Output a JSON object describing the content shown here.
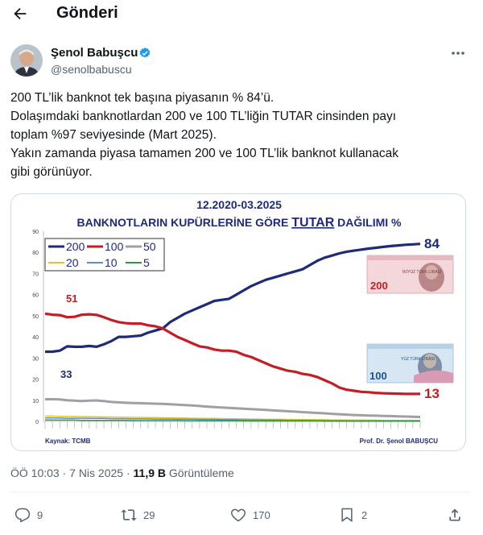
{
  "header": {
    "title": "Gönderi"
  },
  "author": {
    "name": "Şenol Babuşcu",
    "handle": "@senolbabuscu"
  },
  "tweet": {
    "lines": [
      "200 TL’lik banknot tek başına piyasanın % 84’ü.",
      "Dolaşımdaki banknotlardan 200 ve 100 TL’liğin TUTAR cinsinden payı",
      "toplam %97 seviyesinde (Mart 2025).",
      "Yakın zamanda piyasa tamamen 200 ve 100 TL’lik banknot kullanacak",
      "gibi görünüyor."
    ]
  },
  "chart_data": {
    "type": "line",
    "title": "12.2020-03.2025",
    "subtitle_pre": "BANKNOTLARIN KUPÜRLERİNE GÖRE ",
    "subtitle_em": "TUTAR",
    "subtitle_post": " DAĞILIMI %",
    "ylim": [
      0,
      90
    ],
    "yticks": [
      "0",
      "10",
      "20",
      "30",
      "40",
      "50",
      "60",
      "70",
      "80",
      "90"
    ],
    "x": [
      0,
      1,
      2,
      3,
      4,
      5,
      6,
      7,
      8,
      9,
      10,
      11,
      12,
      13,
      14,
      15,
      16,
      17,
      18,
      19,
      20,
      21,
      22,
      23,
      24,
      25,
      26,
      27,
      28,
      29,
      30,
      31,
      32,
      33,
      34,
      35,
      36,
      37,
      38,
      39,
      40,
      41,
      42,
      43,
      44,
      45,
      46,
      47,
      48,
      49,
      50,
      51
    ],
    "series": [
      {
        "name": "200",
        "color": "#1f2a7a",
        "width": 3.2,
        "values": [
          33,
          33,
          33.5,
          35.5,
          35.3,
          35.3,
          35.7,
          35.3,
          36.5,
          38,
          40,
          40,
          40.3,
          40.6,
          42,
          43,
          44,
          47,
          49,
          51,
          52.5,
          54,
          55.5,
          57,
          57.5,
          58,
          60,
          62,
          64,
          65.5,
          67,
          68,
          69,
          70,
          71,
          72,
          74,
          76,
          77.5,
          78.5,
          79.5,
          80.3,
          80.8,
          81.3,
          81.8,
          82.2,
          82.6,
          83,
          83.3,
          83.6,
          83.8,
          84
        ]
      },
      {
        "name": "100",
        "color": "#c41e24",
        "width": 3.2,
        "values": [
          51,
          50.5,
          50.3,
          49.3,
          49.5,
          50.5,
          50.7,
          50.4,
          49.3,
          48,
          47,
          46.5,
          46.3,
          46.3,
          45.5,
          45,
          44,
          42,
          40,
          38.5,
          37,
          35.5,
          35,
          34,
          33.5,
          33.5,
          33,
          31.5,
          30.5,
          29,
          27.5,
          26,
          25,
          24,
          23.5,
          22.5,
          22,
          21,
          19.5,
          18,
          16,
          15,
          14.5,
          14,
          13.8,
          13.5,
          13.3,
          13.2,
          13.1,
          13,
          13,
          13
        ]
      },
      {
        "name": "50",
        "color": "#9ea0a4",
        "width": 3,
        "values": [
          10.5,
          10.5,
          10.4,
          10,
          9.8,
          9.6,
          9.8,
          9.9,
          9.6,
          9.2,
          9,
          8.8,
          8.7,
          8.6,
          8.5,
          8.4,
          8.3,
          8.1,
          7.9,
          7.7,
          7.5,
          7.3,
          7,
          6.8,
          6.6,
          6.4,
          6.2,
          6.0,
          5.8,
          5.6,
          5.4,
          5.2,
          5,
          4.8,
          4.6,
          4.4,
          4.2,
          4,
          3.8,
          3.6,
          3.4,
          3.2,
          3,
          2.9,
          2.8,
          2.7,
          2.6,
          2.5,
          2.4,
          2.3,
          2.2,
          2.1
        ]
      },
      {
        "name": "20",
        "color": "#e8c41e",
        "width": 1.5,
        "values": [
          2.5,
          2.5,
          2.4,
          2.4,
          2.3,
          2.3,
          2.2,
          2.2,
          2.1,
          2.1,
          2,
          2,
          1.9,
          1.9,
          1.8,
          1.8,
          1.7,
          1.7,
          1.6,
          1.6,
          1.5,
          1.5,
          1.4,
          1.4,
          1.3,
          1.3,
          1.2,
          1.2,
          1.1,
          1.1,
          1,
          1,
          1,
          0.9,
          0.9,
          0.9,
          0.8,
          0.8,
          0.8,
          0.7,
          0.7,
          0.7,
          0.6,
          0.6,
          0.6,
          0.6,
          0.5,
          0.5,
          0.5,
          0.5,
          0.5,
          0.5
        ]
      },
      {
        "name": "10",
        "color": "#5a8fc0",
        "width": 1.5,
        "values": [
          1.6,
          1.6,
          1.6,
          1.5,
          1.5,
          1.5,
          1.4,
          1.4,
          1.4,
          1.3,
          1.3,
          1.3,
          1.2,
          1.2,
          1.2,
          1.1,
          1.1,
          1.1,
          1,
          1,
          1,
          0.9,
          0.9,
          0.9,
          0.8,
          0.8,
          0.8,
          0.7,
          0.7,
          0.7,
          0.6,
          0.6,
          0.6,
          0.5,
          0.5,
          0.5,
          0.5,
          0.4,
          0.4,
          0.4,
          0.4,
          0.3,
          0.3,
          0.3,
          0.3,
          0.3,
          0.3,
          0.3,
          0.3,
          0.3,
          0.3,
          0.3
        ]
      },
      {
        "name": "5",
        "color": "#2e9b3e",
        "width": 1.5,
        "values": [
          0.6,
          0.6,
          0.6,
          0.6,
          0.6,
          0.5,
          0.5,
          0.5,
          0.5,
          0.5,
          0.5,
          0.5,
          0.4,
          0.4,
          0.4,
          0.4,
          0.4,
          0.4,
          0.4,
          0.3,
          0.3,
          0.3,
          0.3,
          0.3,
          0.3,
          0.3,
          0.3,
          0.2,
          0.2,
          0.2,
          0.2,
          0.2,
          0.2,
          0.2,
          0.2,
          0.2,
          0.2,
          0.2,
          0.1,
          0.1,
          0.1,
          0.1,
          0.1,
          0.1,
          0.1,
          0.1,
          0.1,
          0.1,
          0.1,
          0.1,
          0.1,
          0.1
        ]
      }
    ],
    "labels": {
      "v200_start": "33",
      "v100_start": "51",
      "v200_end": "84",
      "v100_end": "13"
    },
    "banknotes": {
      "n200": "200",
      "n100": "100",
      "small200": "İKİYÜZ TÜRK LİRASI",
      "small100": "YÜZ TÜRK LİRASI"
    },
    "source": "Kaynak: TCMB",
    "credit": "Prof. Dr. Şenol BABUŞCU",
    "legend_position": "top-left"
  },
  "meta": {
    "time": "ÖÖ 10:03 · 7 Nis 2025 · ",
    "views": "11,9 B",
    "views_label": " Görüntüleme"
  },
  "actions": {
    "replies": "9",
    "reposts": "29",
    "likes": "170",
    "bookmarks": "2"
  },
  "icons": [
    "back-arrow-icon",
    "verified-badge-icon",
    "more-icon",
    "reply-icon",
    "repost-icon",
    "like-icon",
    "bookmark-icon",
    "share-icon"
  ]
}
